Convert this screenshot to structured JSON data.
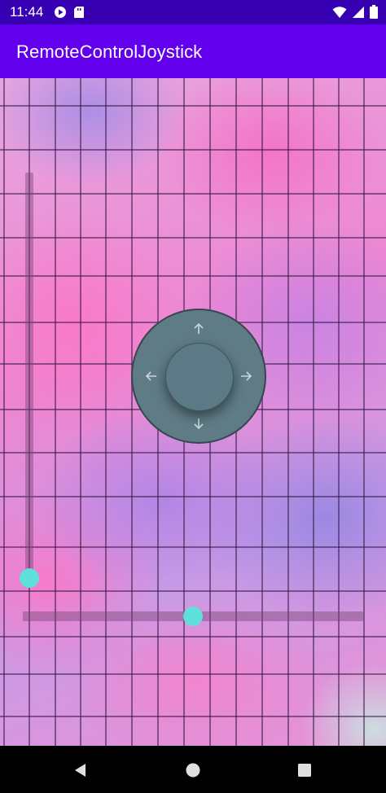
{
  "status_bar": {
    "time": "11:44",
    "left_icons": [
      "play-protect-icon",
      "sd-card-icon"
    ],
    "right_icons": [
      "wifi-icon",
      "signal-icon",
      "battery-icon"
    ],
    "background": "#3700b3"
  },
  "app_bar": {
    "title": "RemoteControlJoystick",
    "background": "#6200ee"
  },
  "joystick": {
    "icons": [
      "arrow-up-icon",
      "arrow-down-icon",
      "arrow-left-icon",
      "arrow-right-icon"
    ],
    "color": "#5f7b86"
  },
  "vertical_slider": {
    "value": 0.0,
    "thumb_color": "#5fe0da"
  },
  "horizontal_slider": {
    "value": 0.5,
    "thumb_color": "#5fe0da"
  },
  "nav_bar": {
    "icons": [
      "back-icon",
      "home-icon",
      "recents-icon"
    ]
  }
}
